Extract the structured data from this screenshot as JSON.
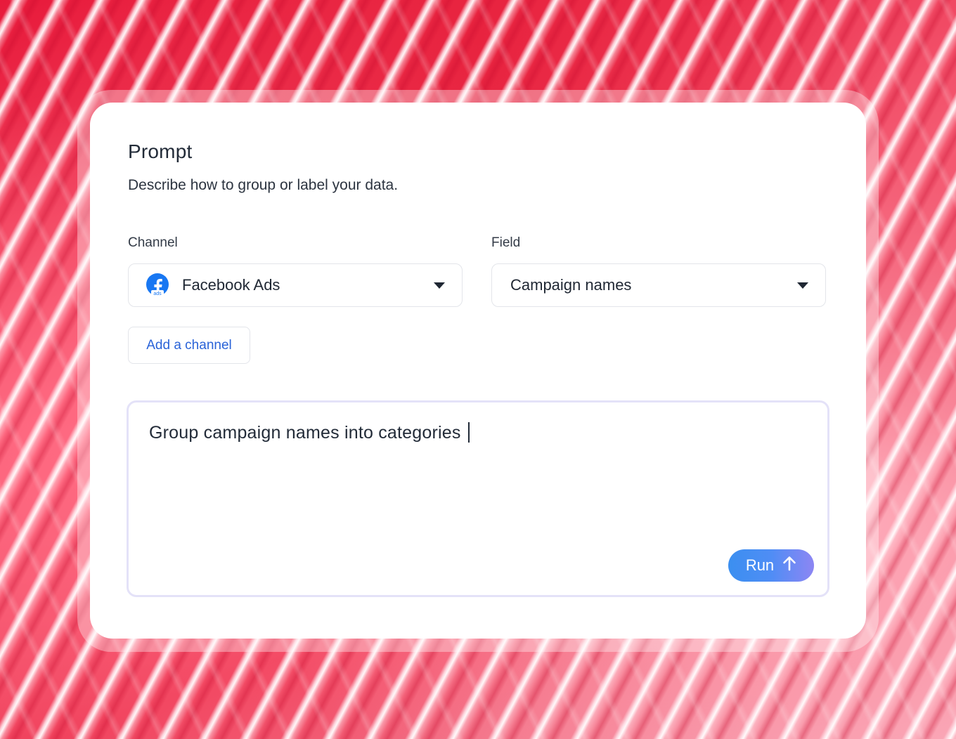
{
  "card": {
    "title": "Prompt",
    "subtitle": "Describe how to group or label your data."
  },
  "channel": {
    "label": "Channel",
    "selected": "Facebook Ads",
    "icon": "facebook-ads-icon",
    "icon_badge": "ads"
  },
  "field": {
    "label": "Field",
    "selected": "Campaign names"
  },
  "add_channel": {
    "label": "Add a channel"
  },
  "prompt_input": {
    "value": "Group campaign names into categories"
  },
  "run_button": {
    "label": "Run",
    "icon": "arrow-up-icon"
  },
  "colors": {
    "accent_link": "#2a63d8",
    "run_gradient_start": "#3b8ff0",
    "run_gradient_end": "#8d86f3",
    "facebook_blue": "#1877f2",
    "background": "#f0455f"
  }
}
